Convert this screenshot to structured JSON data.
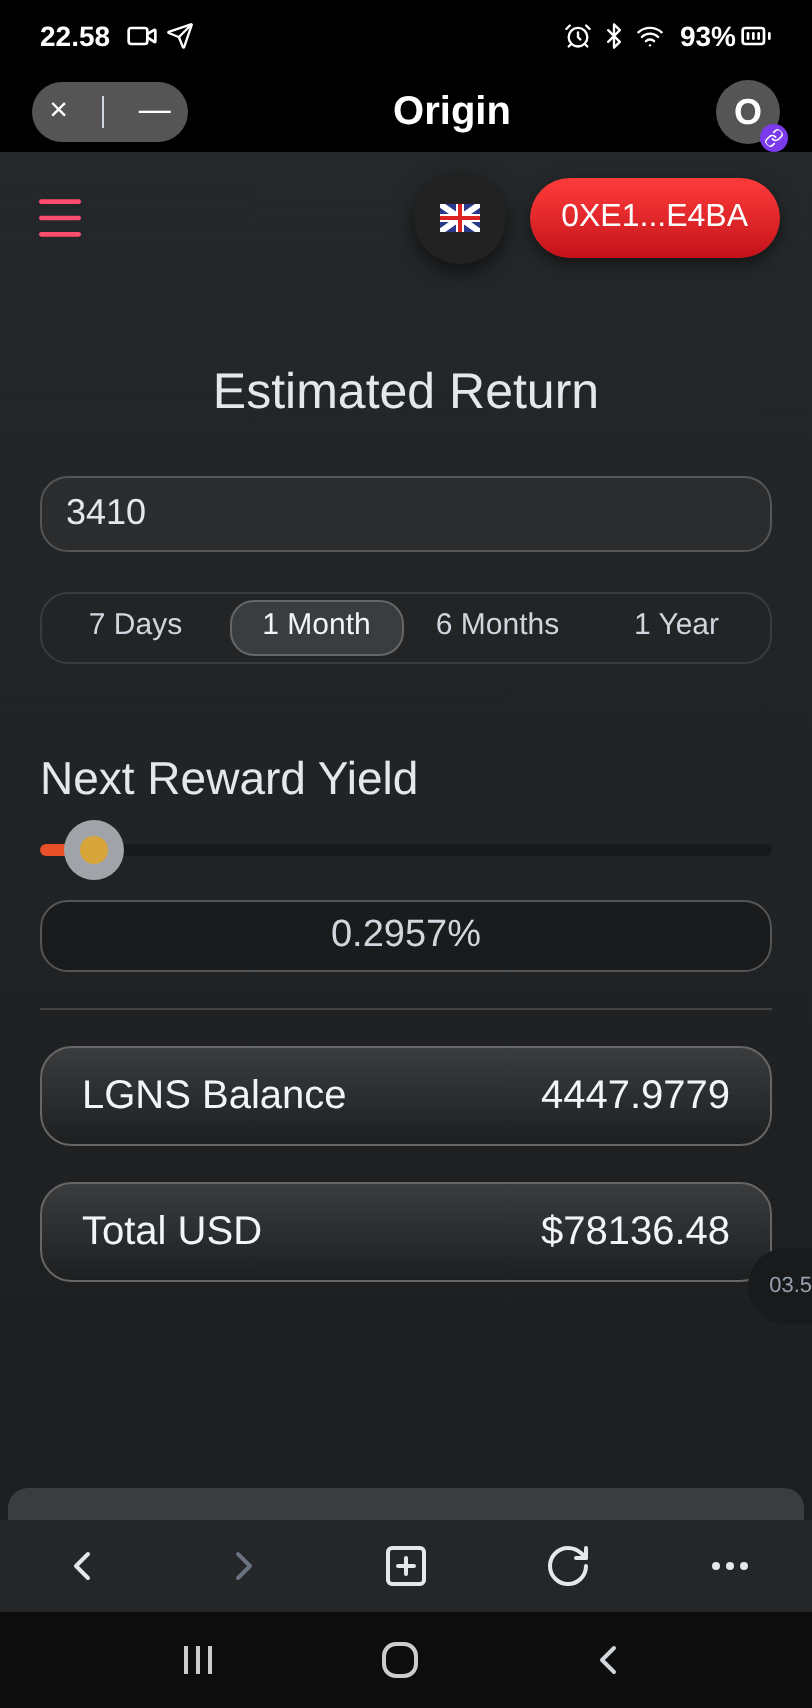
{
  "status_bar": {
    "time": "22.58",
    "battery": "93%"
  },
  "browser": {
    "title": "Origin",
    "close": "×",
    "minimize": "—",
    "profile": "O"
  },
  "header": {
    "wallet": "0XE1...E4BA"
  },
  "calculator": {
    "title": "Estimated Return",
    "amount": "3410",
    "periods": [
      {
        "label": "7 Days",
        "selected": false
      },
      {
        "label": "1 Month",
        "selected": true
      },
      {
        "label": "6 Months",
        "selected": false
      },
      {
        "label": "1 Year",
        "selected": false
      }
    ],
    "yield_title": "Next Reward Yield",
    "yield_slider": {
      "level": 0.05
    },
    "yield_value": "0.2957%",
    "rows": [
      {
        "label": "LGNS Balance",
        "value": "4447.9779"
      },
      {
        "label": "Total USD",
        "value": "$78136.48"
      }
    ]
  },
  "timer_badge": "03.5"
}
